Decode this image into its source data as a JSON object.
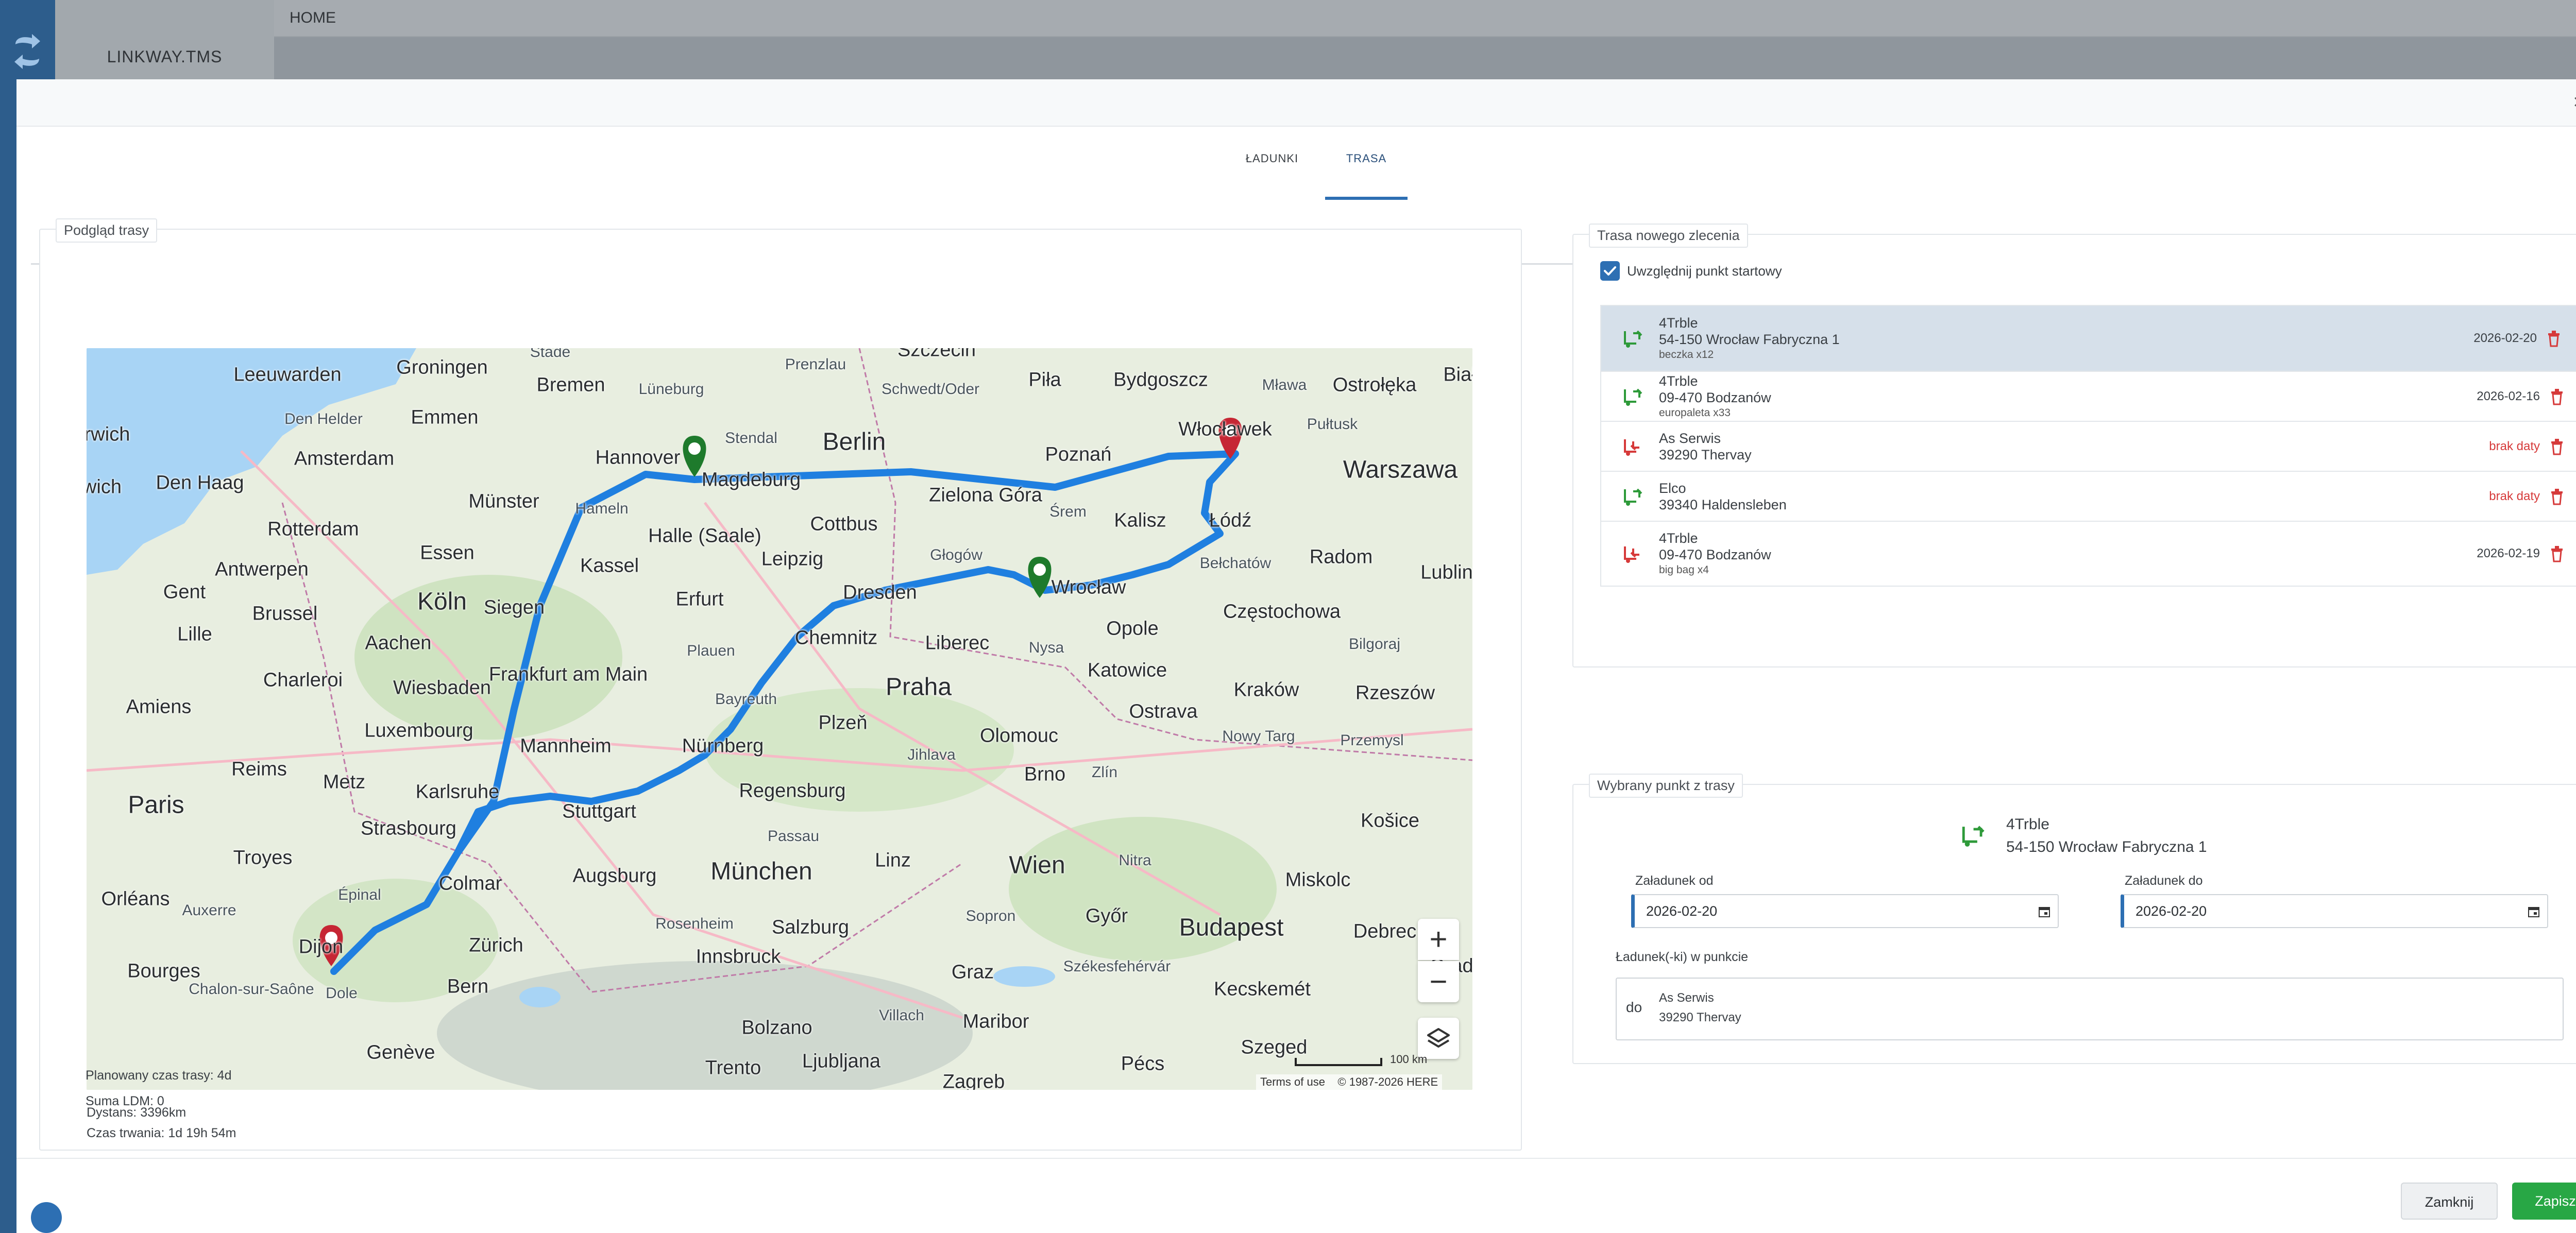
{
  "app": {
    "brand": "LINKWAY.TMS",
    "breadcrumb": "HOME"
  },
  "modal": {
    "close_symbol": "×",
    "tabs": [
      {
        "label": "ŁADUNKI",
        "active": false
      },
      {
        "label": "TRASA",
        "active": true
      }
    ]
  },
  "route_preview": {
    "legend": "Podgląd trasy",
    "map": {
      "provider_terms": "Terms of use",
      "copyright": "© 1987-2026 HERE",
      "scale_label": "100 km",
      "zoom_in": "+",
      "zoom_out": "−",
      "route_color": "#1f7fe0",
      "city_labels": [
        "Leeuwarden",
        "Groningen",
        "Bremen",
        "Lüneburg",
        "Stade",
        "Prenzlau",
        "Szczecin",
        "Piła",
        "Bydgoszcz",
        "Mława",
        "Ostrołęka",
        "Biał",
        "rwich",
        "Den Helder",
        "Emmen",
        "Hannover",
        "Stendal",
        "Berlin",
        "Schwedt/Oder",
        "Poznań",
        "Włocławek",
        "Pułtusk",
        "Amsterdam",
        "Den Haag",
        "Münster",
        "Magdeburg",
        "Zielona Góra",
        "Warszawa",
        "wich",
        "Rotterdam",
        "Hameln",
        "Halle (Saale)",
        "Cottbus",
        "Kalisz",
        "Łódź",
        "Essen",
        "Kassel",
        "Leipzig",
        "Głogów",
        "Śrem",
        "Radom",
        "Lublin",
        "Gent",
        "Antwerpen",
        "Köln",
        "Erfurt",
        "Dresden",
        "Wrocław",
        "Bełchatów",
        "Brussel",
        "Siegen",
        "Chemnitz",
        "Opole",
        "Częstochowa",
        "Lille",
        "Aachen",
        "Plauen",
        "Liberec",
        "Nysa",
        "Katowice",
        "Bilgoraj",
        "Charleroi",
        "Frankfurt am Main",
        "Praha",
        "Kraków",
        "Rzeszów",
        "Amiens",
        "Wiesbaden",
        "Bayreuth",
        "Plzeň",
        "Olomouc",
        "Ostrava",
        "Nowy Targ",
        "Luxembourg",
        "Mannheim",
        "Nürnberg",
        "Jihlava",
        "Brno",
        "Zlín",
        "Przemysl",
        "Metz",
        "Reims",
        "Karlsruhe",
        "Regensburg",
        "Paris",
        "Stuttgart",
        "Strasbourg",
        "Passau",
        "Linz",
        "Wien",
        "Nitra",
        "Košice",
        "Troyes",
        "Augsburg",
        "München",
        "Miskolc",
        "Orléans",
        "Colmar",
        "Épinal",
        "Auxerre",
        "Zürich",
        "Rosenheim",
        "Salzburg",
        "Sopron",
        "Győr",
        "Budapest",
        "Debrec",
        "Dijon",
        "Dole",
        "Bern",
        "Innsbruck",
        "Graz",
        "Székesfehérvár",
        "Bourges",
        "Chalon-sur-Saône",
        "Genève",
        "Bolzano",
        "Villach",
        "Maribor",
        "Kecskemét",
        "Orade",
        "Trento",
        "Ljubljana",
        "Pécs",
        "Szeged",
        "Zagreb"
      ]
    },
    "stats": {
      "distance": "Dystans: 3396km",
      "duration": "Czas trwania: 1d 19h 54m",
      "planned": "Planowany czas trasy: 4d",
      "ldm": "Suma LDM: 0"
    }
  },
  "route": {
    "legend": "Trasa nowego zlecenia",
    "include_start_label": "Uwzględnij punkt startowy",
    "include_start_checked": true,
    "items": [
      {
        "type": "loading",
        "name": "4Trble",
        "address": "54-150 Wrocław Fabryczna 1",
        "cargo": "beczka x12",
        "date": "2026-02-20",
        "active": true
      },
      {
        "type": "loading",
        "name": "4Trble",
        "address": "09-470 Bodzanów",
        "cargo": "europaleta x33",
        "date": "2026-02-16",
        "active": false
      },
      {
        "type": "unloading",
        "name": "As Serwis",
        "address": "39290 Thervay",
        "cargo": "",
        "date": "brak daty",
        "active": false
      },
      {
        "type": "loading",
        "name": "Elco",
        "address": "39340 Haldensleben",
        "cargo": "",
        "date": "brak daty",
        "active": false
      },
      {
        "type": "unloading",
        "name": "4Trble",
        "address": "09-470 Bodzanów",
        "cargo": "big bag x4",
        "date": "2026-02-19",
        "active": false
      }
    ]
  },
  "selected_point": {
    "legend": "Wybrany punkt z trasy",
    "name": "4Trble",
    "address": "54-150 Wrocław Fabryczna 1",
    "from_label": "Załadunek od",
    "from_value": "2026-02-20",
    "to_label": "Załadunek do",
    "to_value": "2026-02-20",
    "cargo_label": "Ładunek(-ki) w punkcie",
    "cargo_prefix": "do",
    "cargo_name": "As Serwis",
    "cargo_address": "39290 Thervay"
  },
  "footer": {
    "close_label": "Zamknij",
    "save_label": "Zapisz"
  },
  "colors": {
    "primary": "#2d6fb3",
    "save": "#28a745",
    "loading_icon": "#2e9a3a",
    "unloading_icon": "#d63a3a",
    "no_date": "#d63a3a"
  }
}
